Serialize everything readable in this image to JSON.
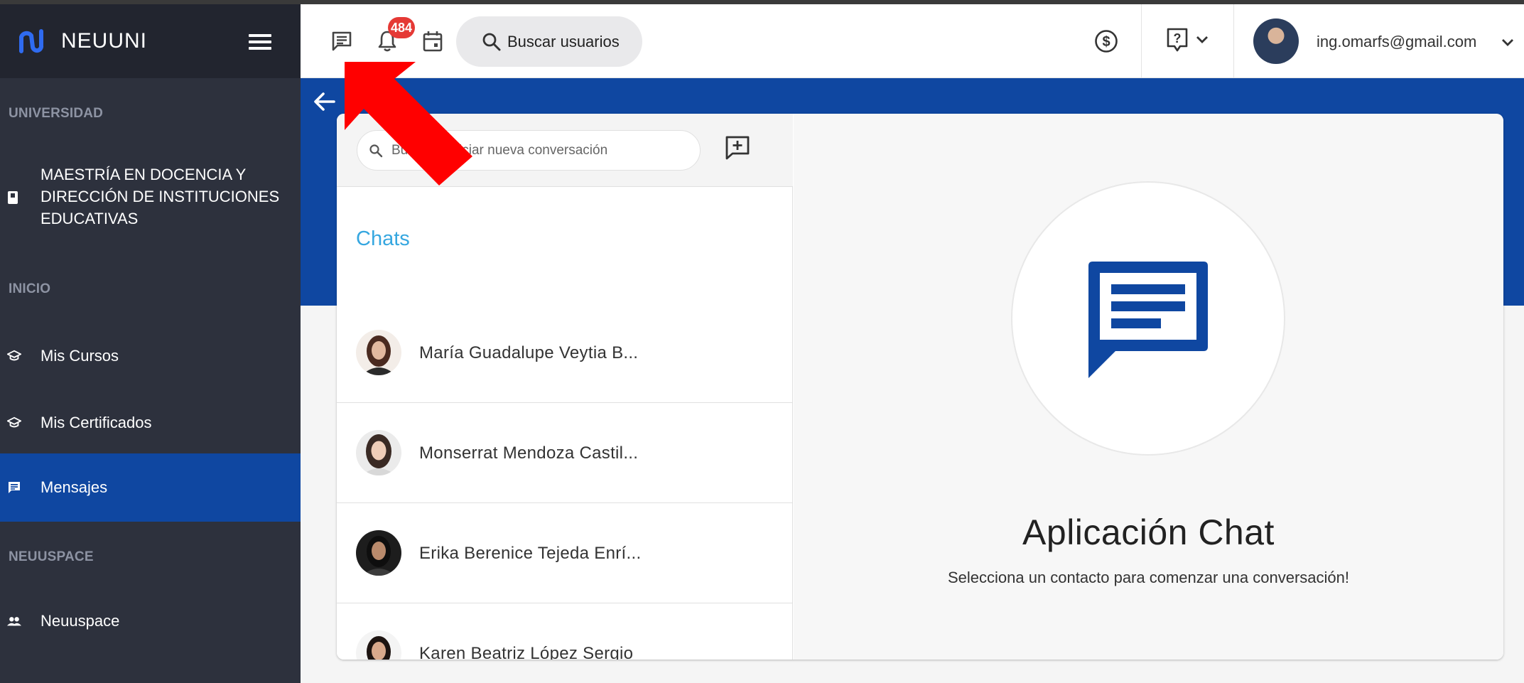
{
  "brand": {
    "name": "NEUUNI"
  },
  "sidebar": {
    "section_universidad": "UNIVERSIDAD",
    "program": "MAESTRÍA EN DOCENCIA Y DIRECCIÓN DE INSTITUCIONES EDUCATIVAS",
    "section_inicio": "INICIO",
    "items": [
      {
        "label": "Mis Cursos",
        "icon": "graduation-cap-icon"
      },
      {
        "label": "Mis Certificados",
        "icon": "graduation-cap-icon"
      },
      {
        "label": "Mensajes",
        "icon": "message-icon",
        "active": true
      }
    ],
    "section_neuuspace": "NEUUSPACE",
    "neuuspace_item": {
      "label": "Neuuspace",
      "icon": "people-icon"
    }
  },
  "topbar": {
    "notification_count": "484",
    "search_users_label": "Buscar usuarios",
    "user_email": "ing.omarfs@gmail.com"
  },
  "chat": {
    "search_placeholder": "Buscar o iniciar nueva conversación",
    "chats_title": "Chats",
    "contacts": [
      {
        "name": "María Guadalupe Veytia B..."
      },
      {
        "name": "Monserrat Mendoza Castil..."
      },
      {
        "name": "Erika Berenice Tejeda Enrí..."
      },
      {
        "name": "Karen Beatriz López Sergio"
      }
    ],
    "app_title": "Aplicación Chat",
    "app_subtitle": "Selecciona un contacto para comenzar una conversación!"
  },
  "colors": {
    "primary_blue": "#0f47a1",
    "sidebar_bg": "#2d313d",
    "badge_red": "#e53935",
    "chats_title": "#36a7e0",
    "annotation_arrow": "#ff0000"
  }
}
